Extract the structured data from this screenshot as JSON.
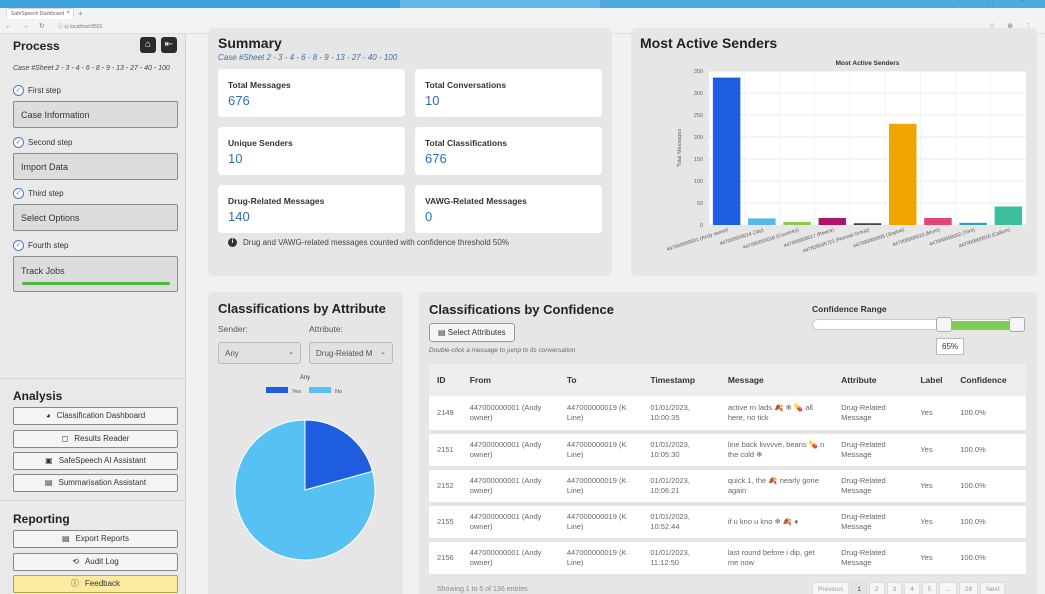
{
  "browser": {
    "tab_title": "SafeSpeech Dashboard",
    "url": "localhost:8501"
  },
  "sidebar": {
    "title": "Process",
    "case_text": "Case #Sheet 2 - 3 - 4 - 6 - 8 - 9 - 13 - 27 - 40 - 100",
    "steps": [
      {
        "label": "First step",
        "box": "Case Information"
      },
      {
        "label": "Second step",
        "box": "Import Data"
      },
      {
        "label": "Third step",
        "box": "Select Options"
      },
      {
        "label": "Fourth step",
        "box": "Track Jobs"
      }
    ],
    "analysis_title": "Analysis",
    "analysis_buttons": [
      "Classification Dashboard",
      "Results Reader",
      "SafeSpeech AI Assistant",
      "Summarisation Assistant"
    ],
    "reporting_title": "Reporting",
    "reporting_buttons": [
      "Export Reports",
      "Audit Log",
      "Feedback"
    ],
    "track_jobs_progress": 1.0
  },
  "summary": {
    "title": "Summary",
    "case_text": "Case #Sheet 2 - 3 - 4 - 6 - 8 - 9 - 13 - 27 - 40 - 100",
    "tiles": [
      {
        "label": "Total Messages",
        "value": "676"
      },
      {
        "label": "Total Conversations",
        "value": "10"
      },
      {
        "label": "Unique Senders",
        "value": "10"
      },
      {
        "label": "Total Classifications",
        "value": "676"
      },
      {
        "label": "Drug-Related Messages",
        "value": "140"
      },
      {
        "label": "VAWG-Related Messages",
        "value": "0"
      }
    ],
    "note": "Drug and VAWG-related messages counted with confidence threshold 50%"
  },
  "senders": {
    "title": "Most Active Senders"
  },
  "attribute": {
    "title": "Classifications by Attribute",
    "sender_label": "Sender:",
    "attribute_label": "Attribute:",
    "sender_value": "Any",
    "attribute_value": "Drug-Related M"
  },
  "confidence": {
    "title": "Classifications by Confidence",
    "select_button": "Select Attributes",
    "hint": "Double-click a message to jump to its conversation",
    "range_label": "Confidence Range",
    "range_value": "65%",
    "range_fraction": 0.65,
    "columns": [
      "ID",
      "From",
      "To",
      "Timestamp",
      "Message",
      "Attribute",
      "Label",
      "Confidence"
    ],
    "rows": [
      {
        "id": "2149",
        "from": "447000000001 (Andy owner)",
        "to": "447000000019 (K Line)",
        "ts": "01/01/2023, 10:00:35",
        "msg": "active rn lads 🍂 ❄ 💊 all here, no tick",
        "attr": "Drug-Related Message",
        "label": "Yes",
        "conf": "100.0%"
      },
      {
        "id": "2151",
        "from": "447000000001 (Andy owner)",
        "to": "447000000019 (K Line)",
        "ts": "01/01/2023, 10:05:30",
        "msg": "line back livvvve, beans 💊 n the cold ❄",
        "attr": "Drug-Related Message",
        "label": "Yes",
        "conf": "100.0%"
      },
      {
        "id": "2152",
        "from": "447000000001 (Andy owner)",
        "to": "447000000019 (K Line)",
        "ts": "01/01/2023, 10:06:21",
        "msg": "quick 1, the 🍂 nearly gone again",
        "attr": "Drug-Related Message",
        "label": "Yes",
        "conf": "100.0%"
      },
      {
        "id": "2155",
        "from": "447000000001 (Andy owner)",
        "to": "447000000019 (K Line)",
        "ts": "01/01/2023, 10:52:44",
        "msg": "if u kno u kno ❄ 🍂 ♦",
        "attr": "Drug-Related Message",
        "label": "Yes",
        "conf": "100.0%"
      },
      {
        "id": "2156",
        "from": "447000000001 (Andy owner)",
        "to": "447000000019 (K Line)",
        "ts": "01/01/2023, 11:12:50",
        "msg": "last round before i dip, get me now",
        "attr": "Drug-Related Message",
        "label": "Yes",
        "conf": "100.0%"
      }
    ],
    "footer": "Showing 1 to 5 of 136 entries",
    "pages": [
      "Previous",
      "1",
      "2",
      "3",
      "4",
      "5",
      "...",
      "28",
      "Next"
    ]
  },
  "chart_data": [
    {
      "type": "bar",
      "title": "Most Active Senders",
      "ylabel": "Total Messages",
      "xlabel": "",
      "ylim": [
        0,
        350
      ],
      "yticks": [
        0,
        50,
        100,
        150,
        200,
        250,
        300,
        350
      ],
      "categories": [
        "447000000001 (Andy owner)",
        "447000000014 (Jay)",
        "447000000018 (Courtney)",
        "447000000017 (Reece)",
        "447826535721 (Normal Group)",
        "447000000005 (Sophie)",
        "447000000010 (Mum)",
        "447000000002 (Tom)",
        "447000000016 (Callum)"
      ],
      "values": [
        335,
        15,
        7,
        16,
        4,
        230,
        16,
        5,
        42
      ],
      "colors": [
        "#1f5de0",
        "#56b7e8",
        "#8cc84b",
        "#b0136e",
        "#444444",
        "#f0a500",
        "#e2457a",
        "#2ea2b8",
        "#3cbf9c"
      ],
      "grid": true
    },
    {
      "type": "pie",
      "title": "Any",
      "legend": [
        "Yes",
        "No"
      ],
      "values": [
        20.7,
        79.3
      ],
      "colors": [
        "#1f5de0",
        "#56c1f2"
      ],
      "legend_position": "top"
    }
  ]
}
